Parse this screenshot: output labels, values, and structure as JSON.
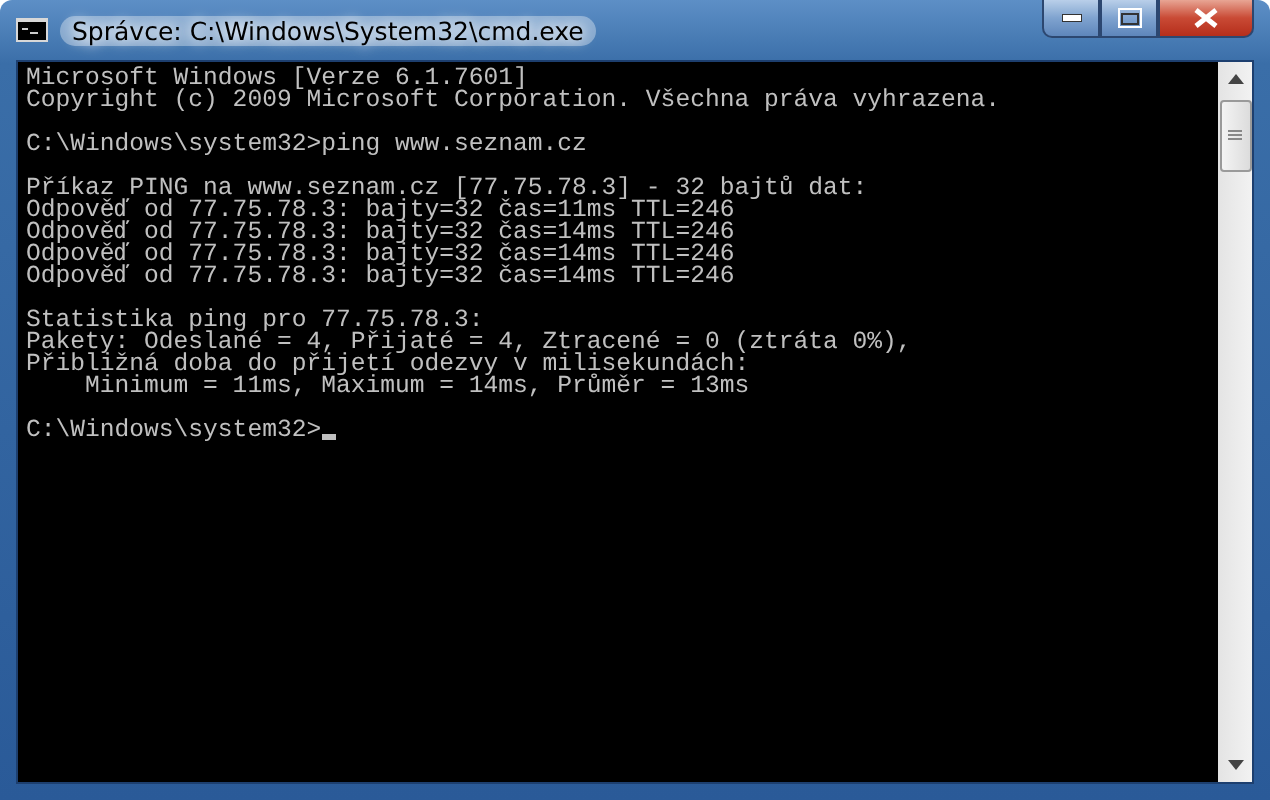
{
  "window": {
    "title": "Správce: C:\\Windows\\System32\\cmd.exe"
  },
  "console": {
    "blocks": [
      [
        "Microsoft Windows [Verze 6.1.7601]",
        "Copyright (c) 2009 Microsoft Corporation. Všechna práva vyhrazena."
      ],
      [
        "C:\\Windows\\system32>ping www.seznam.cz"
      ],
      [
        "Příkaz PING na www.seznam.cz [77.75.78.3] - 32 bajtů dat:",
        "Odpověď od 77.75.78.3: bajty=32 čas=11ms TTL=246",
        "Odpověď od 77.75.78.3: bajty=32 čas=14ms TTL=246",
        "Odpověď od 77.75.78.3: bajty=32 čas=14ms TTL=246",
        "Odpověď od 77.75.78.3: bajty=32 čas=14ms TTL=246"
      ],
      [
        "Statistika ping pro 77.75.78.3:",
        "Pakety: Odeslané = 4, Přijaté = 4, Ztracené = 0 (ztráta 0%),",
        "Přibližná doba do přijetí odezvy v milisekundách:",
        "    Minimum = 11ms, Maximum = 14ms, Průměr = 13ms"
      ]
    ],
    "prompt": "C:\\Windows\\system32>"
  }
}
